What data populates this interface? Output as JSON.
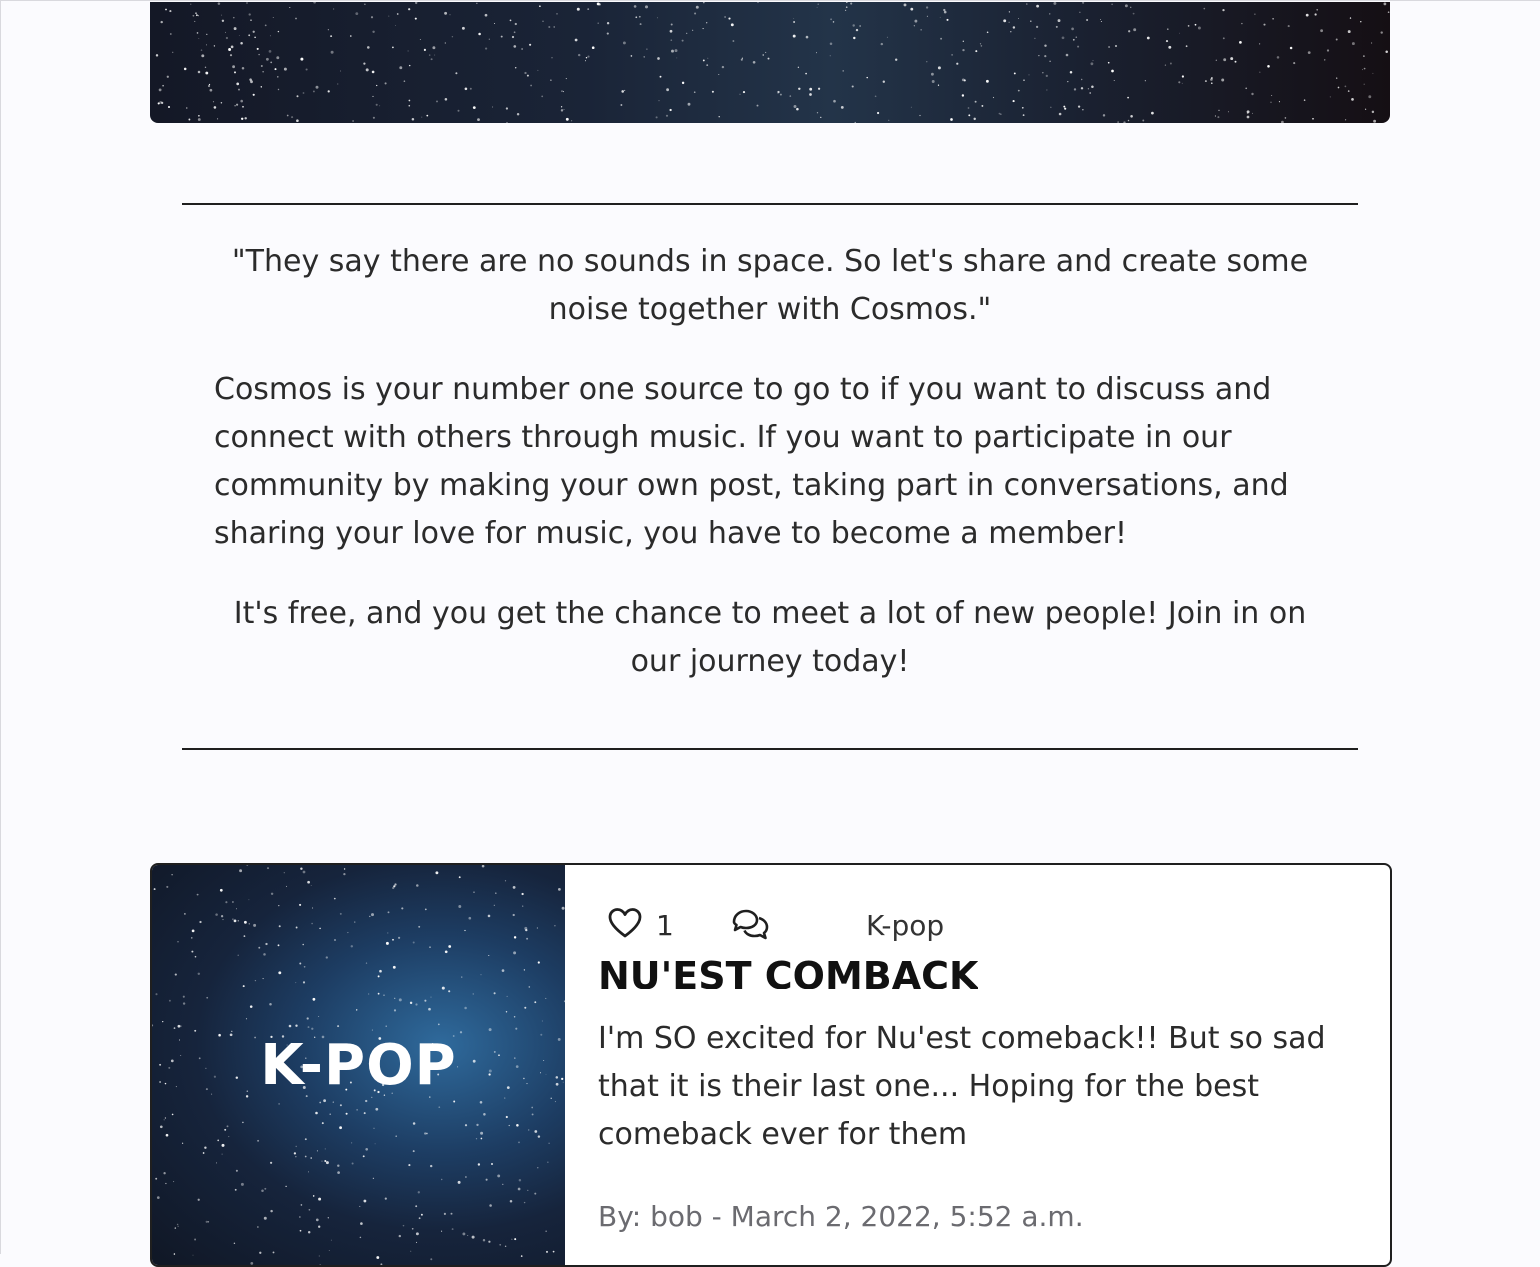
{
  "intro": {
    "quote": "\"They say there are no sounds in space. So let's share and create some noise together with Cosmos.\"",
    "about": "Cosmos is your number one source to go to if you want to discuss and connect with others through music. If you want to participate in our community by making your own post, taking part in conversations, and sharing your love for music, you have to become a member!",
    "join": "It's free, and you get the chance to meet a lot of new people! Join in on our journey today!"
  },
  "post": {
    "thumbnail_text": "K-POP",
    "like_icon": "heart-icon",
    "likes": "1",
    "comment_icon": "comments-icon",
    "category": "K-pop",
    "title": "NU'EST COMBACK",
    "body": "I'm SO excited for Nu'est comeback!! But so sad that it is their last one... Hoping for the best comeback ever for them",
    "byline": "By: bob - March 2, 2022, 5:52 a.m."
  }
}
